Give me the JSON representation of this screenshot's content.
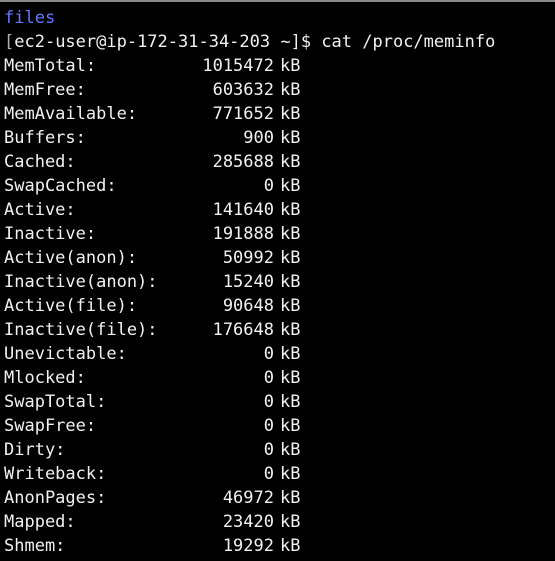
{
  "colors": {
    "background": "#000000",
    "text": "#f2f2f2",
    "previous_output": "#5e7bff"
  },
  "previous_output": "files",
  "prompt": {
    "open_bracket": "[",
    "user_host": "ec2-user@ip-172-31-34-203 ~]$",
    "command": "cat /proc/meminfo"
  },
  "meminfo": [
    {
      "key": "MemTotal:",
      "value": "1015472",
      "unit": "kB"
    },
    {
      "key": "MemFree:",
      "value": "603632",
      "unit": "kB"
    },
    {
      "key": "MemAvailable:",
      "value": "771652",
      "unit": "kB"
    },
    {
      "key": "Buffers:",
      "value": "900",
      "unit": "kB"
    },
    {
      "key": "Cached:",
      "value": "285688",
      "unit": "kB"
    },
    {
      "key": "SwapCached:",
      "value": "0",
      "unit": "kB"
    },
    {
      "key": "Active:",
      "value": "141640",
      "unit": "kB"
    },
    {
      "key": "Inactive:",
      "value": "191888",
      "unit": "kB"
    },
    {
      "key": "Active(anon):",
      "value": "50992",
      "unit": "kB"
    },
    {
      "key": "Inactive(anon):",
      "value": "15240",
      "unit": "kB"
    },
    {
      "key": "Active(file):",
      "value": "90648",
      "unit": "kB"
    },
    {
      "key": "Inactive(file):",
      "value": "176648",
      "unit": "kB"
    },
    {
      "key": "Unevictable:",
      "value": "0",
      "unit": "kB"
    },
    {
      "key": "Mlocked:",
      "value": "0",
      "unit": "kB"
    },
    {
      "key": "SwapTotal:",
      "value": "0",
      "unit": "kB"
    },
    {
      "key": "SwapFree:",
      "value": "0",
      "unit": "kB"
    },
    {
      "key": "Dirty:",
      "value": "0",
      "unit": "kB"
    },
    {
      "key": "Writeback:",
      "value": "0",
      "unit": "kB"
    },
    {
      "key": "AnonPages:",
      "value": "46972",
      "unit": "kB"
    },
    {
      "key": "Mapped:",
      "value": "23420",
      "unit": "kB"
    },
    {
      "key": "Shmem:",
      "value": "19292",
      "unit": "kB"
    }
  ]
}
